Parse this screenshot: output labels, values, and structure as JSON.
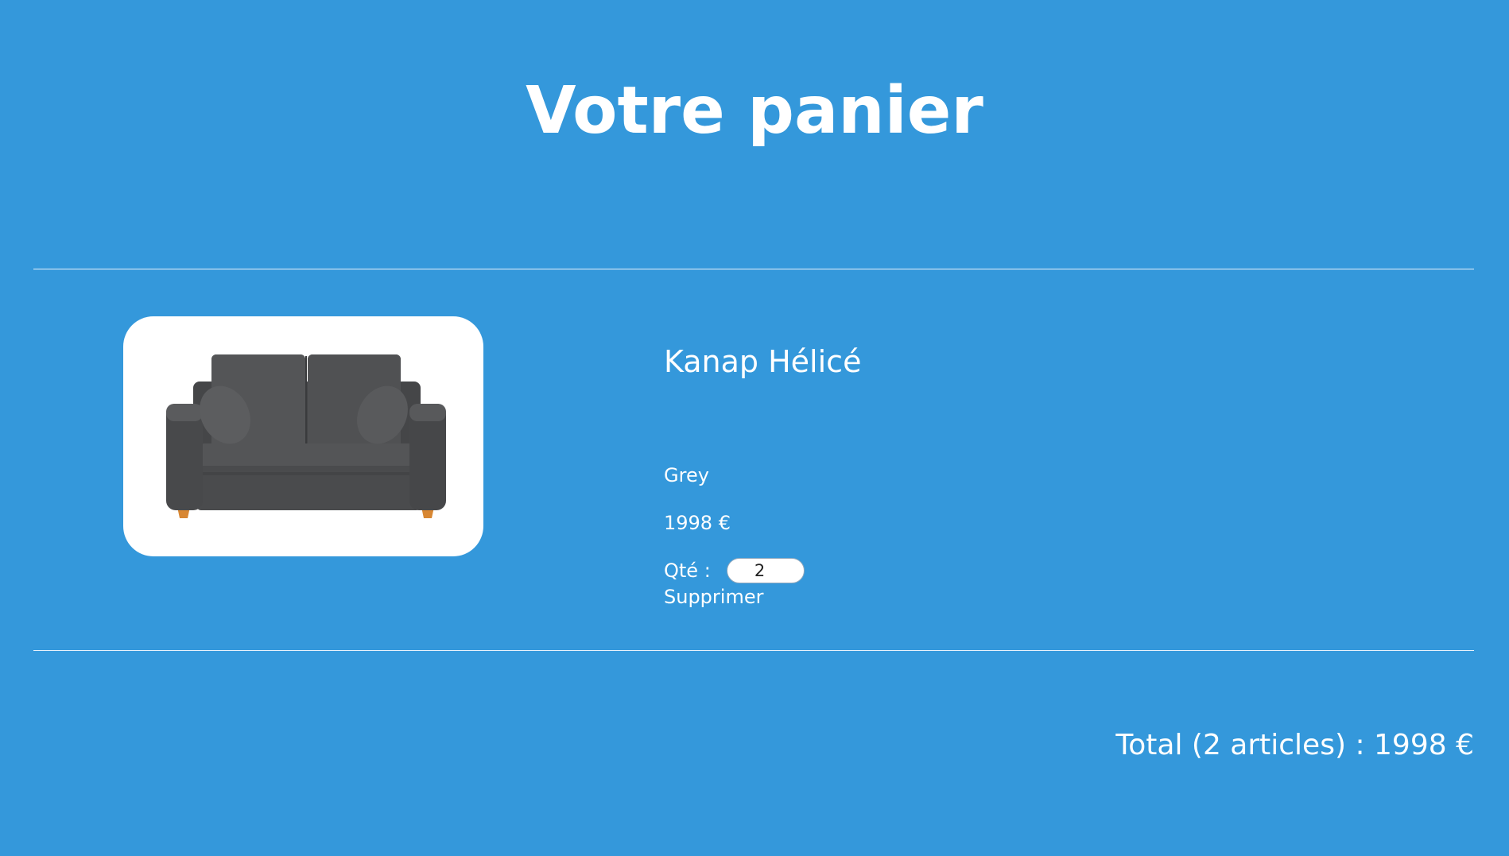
{
  "page": {
    "title": "Votre panier"
  },
  "cart": {
    "items": [
      {
        "name": "Kanap Hélicé",
        "color": "Grey",
        "price": "1998 €",
        "quantity_label": "Qté :",
        "quantity": "2",
        "delete_label": "Supprimer",
        "image": "grey-sofa"
      }
    ]
  },
  "summary": {
    "total_text": "Total (2 articles) : 1998 €"
  },
  "colors": {
    "background": "#3498db",
    "text": "#ffffff",
    "card": "#ffffff"
  }
}
